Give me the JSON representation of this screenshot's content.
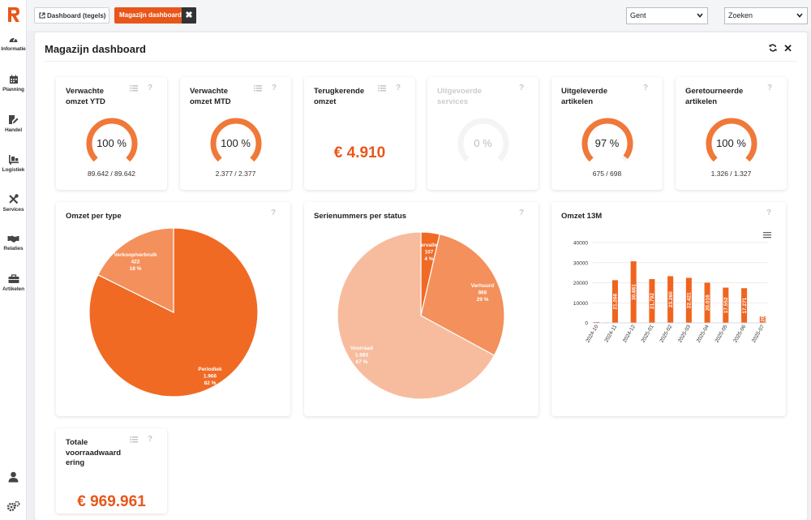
{
  "sidebar": {
    "items": [
      {
        "label": "Informatie",
        "icon": "dashboard-gauge-icon"
      },
      {
        "label": "Planning",
        "icon": "calendar-icon"
      },
      {
        "label": "Handel",
        "icon": "edit-document-icon"
      },
      {
        "label": "Logistiek",
        "icon": "dolly-icon"
      },
      {
        "label": "Services",
        "icon": "tools-icon"
      },
      {
        "label": "Relaties",
        "icon": "handshake-icon"
      },
      {
        "label": "Artikelen",
        "icon": "toolbox-icon"
      }
    ],
    "bottom_icons": [
      "user-icon",
      "settings-cogs-icon"
    ]
  },
  "topbar": {
    "tabs": [
      {
        "label": "Dashboard (tegels)",
        "icon": "external-link-icon"
      },
      {
        "label": "Magazijn dashboard",
        "active": true
      }
    ],
    "close_symbol": "✖",
    "location_select": "Gent",
    "search_select": "Zoeken"
  },
  "panel": {
    "title": "Magazijn dashboard",
    "close_symbol": "✕"
  },
  "colors": {
    "accent": "#e8561a",
    "gauge": "#f07838",
    "pie_dark": "#f06a24",
    "pie_mid": "#f4905c",
    "pie_light": "#f7bc9e",
    "bar": "#f0641e"
  },
  "tiles": [
    {
      "title": "Verwachte omzet YTD",
      "percent": 100,
      "percent_label": "100 %",
      "sub": "89.642 / 89.642"
    },
    {
      "title": "Verwachte omzet MTD",
      "percent": 100,
      "percent_label": "100 %",
      "sub": "2.377 / 2.377"
    },
    {
      "title": "Terugkerende omzet",
      "value": "€ 4.910"
    },
    {
      "title": "Uitgevoerde services",
      "percent": 0,
      "percent_label": "0 %"
    },
    {
      "title": "Uitgeleverde artikelen",
      "percent": 97,
      "percent_label": "97 %",
      "sub": "675 / 698"
    },
    {
      "title": "Geretourneerde artikelen",
      "percent": 100,
      "percent_label": "100 %",
      "sub": "1.326 / 1.327"
    },
    {
      "title": "Totale voorraadwaarde ering",
      "value": "€ 969.961"
    }
  ],
  "tile_title_lines": [
    [
      "Verwachte",
      "omzet YTD"
    ],
    [
      "Verwachte",
      "omzet MTD"
    ],
    [
      "Terugkerende",
      "omzet"
    ],
    [
      "Uitgevoerde",
      "services"
    ],
    [
      "Uitgeleverde",
      "artikelen"
    ],
    [
      "Geretourneerde",
      "artikelen"
    ],
    [
      "Totale",
      "voorraadwaard",
      "ering"
    ]
  ],
  "help_symbol": "?",
  "chart_data": [
    {
      "type": "pie",
      "title": "Omzet per type",
      "slices": [
        {
          "label": "Periodiek",
          "value": 1966,
          "value_label": "1.966",
          "percent_label": "82 %"
        },
        {
          "label": "Verkoop/verbruik",
          "value": 422,
          "value_label": "422",
          "percent_label": "18 %"
        }
      ]
    },
    {
      "type": "pie",
      "title": "Serienummers per status",
      "slices": [
        {
          "label": "Vervallen",
          "value": 107,
          "value_label": "107",
          "percent_label": "4 %"
        },
        {
          "label": "Verhuurd",
          "value": 866,
          "value_label": "866",
          "percent_label": "29 %"
        },
        {
          "label": "Voorraad",
          "value": 1983,
          "value_label": "1.983",
          "percent_label": "67 %"
        }
      ]
    },
    {
      "type": "bar",
      "title": "Omzet 13M",
      "categories": [
        "2024-10",
        "",
        "2024-11",
        "",
        "2024-12",
        "",
        "2025-01",
        "",
        "2025-02",
        "",
        "2025-03",
        "",
        "2025-04",
        "",
        "2025-05",
        "",
        "2025-06",
        "",
        "2025-07"
      ],
      "values": [
        400,
        200,
        21266,
        null,
        30661,
        null,
        21792,
        null,
        23260,
        null,
        22421,
        null,
        20016,
        null,
        17552,
        null,
        17271,
        null,
        3200
      ],
      "value_labels": [
        "",
        "",
        "21.266",
        "",
        "30.661",
        "",
        "21.792",
        "",
        "23.260",
        "",
        "22.421",
        "",
        "20.016",
        "",
        "17.552",
        "",
        "17.271",
        "",
        "3.200"
      ],
      "yticks": [
        0,
        10000,
        20000,
        30000,
        40000
      ],
      "ylim": [
        0,
        40000
      ],
      "grid": true,
      "legend": "none",
      "menu_icon": "hamburger-menu-icon"
    }
  ]
}
